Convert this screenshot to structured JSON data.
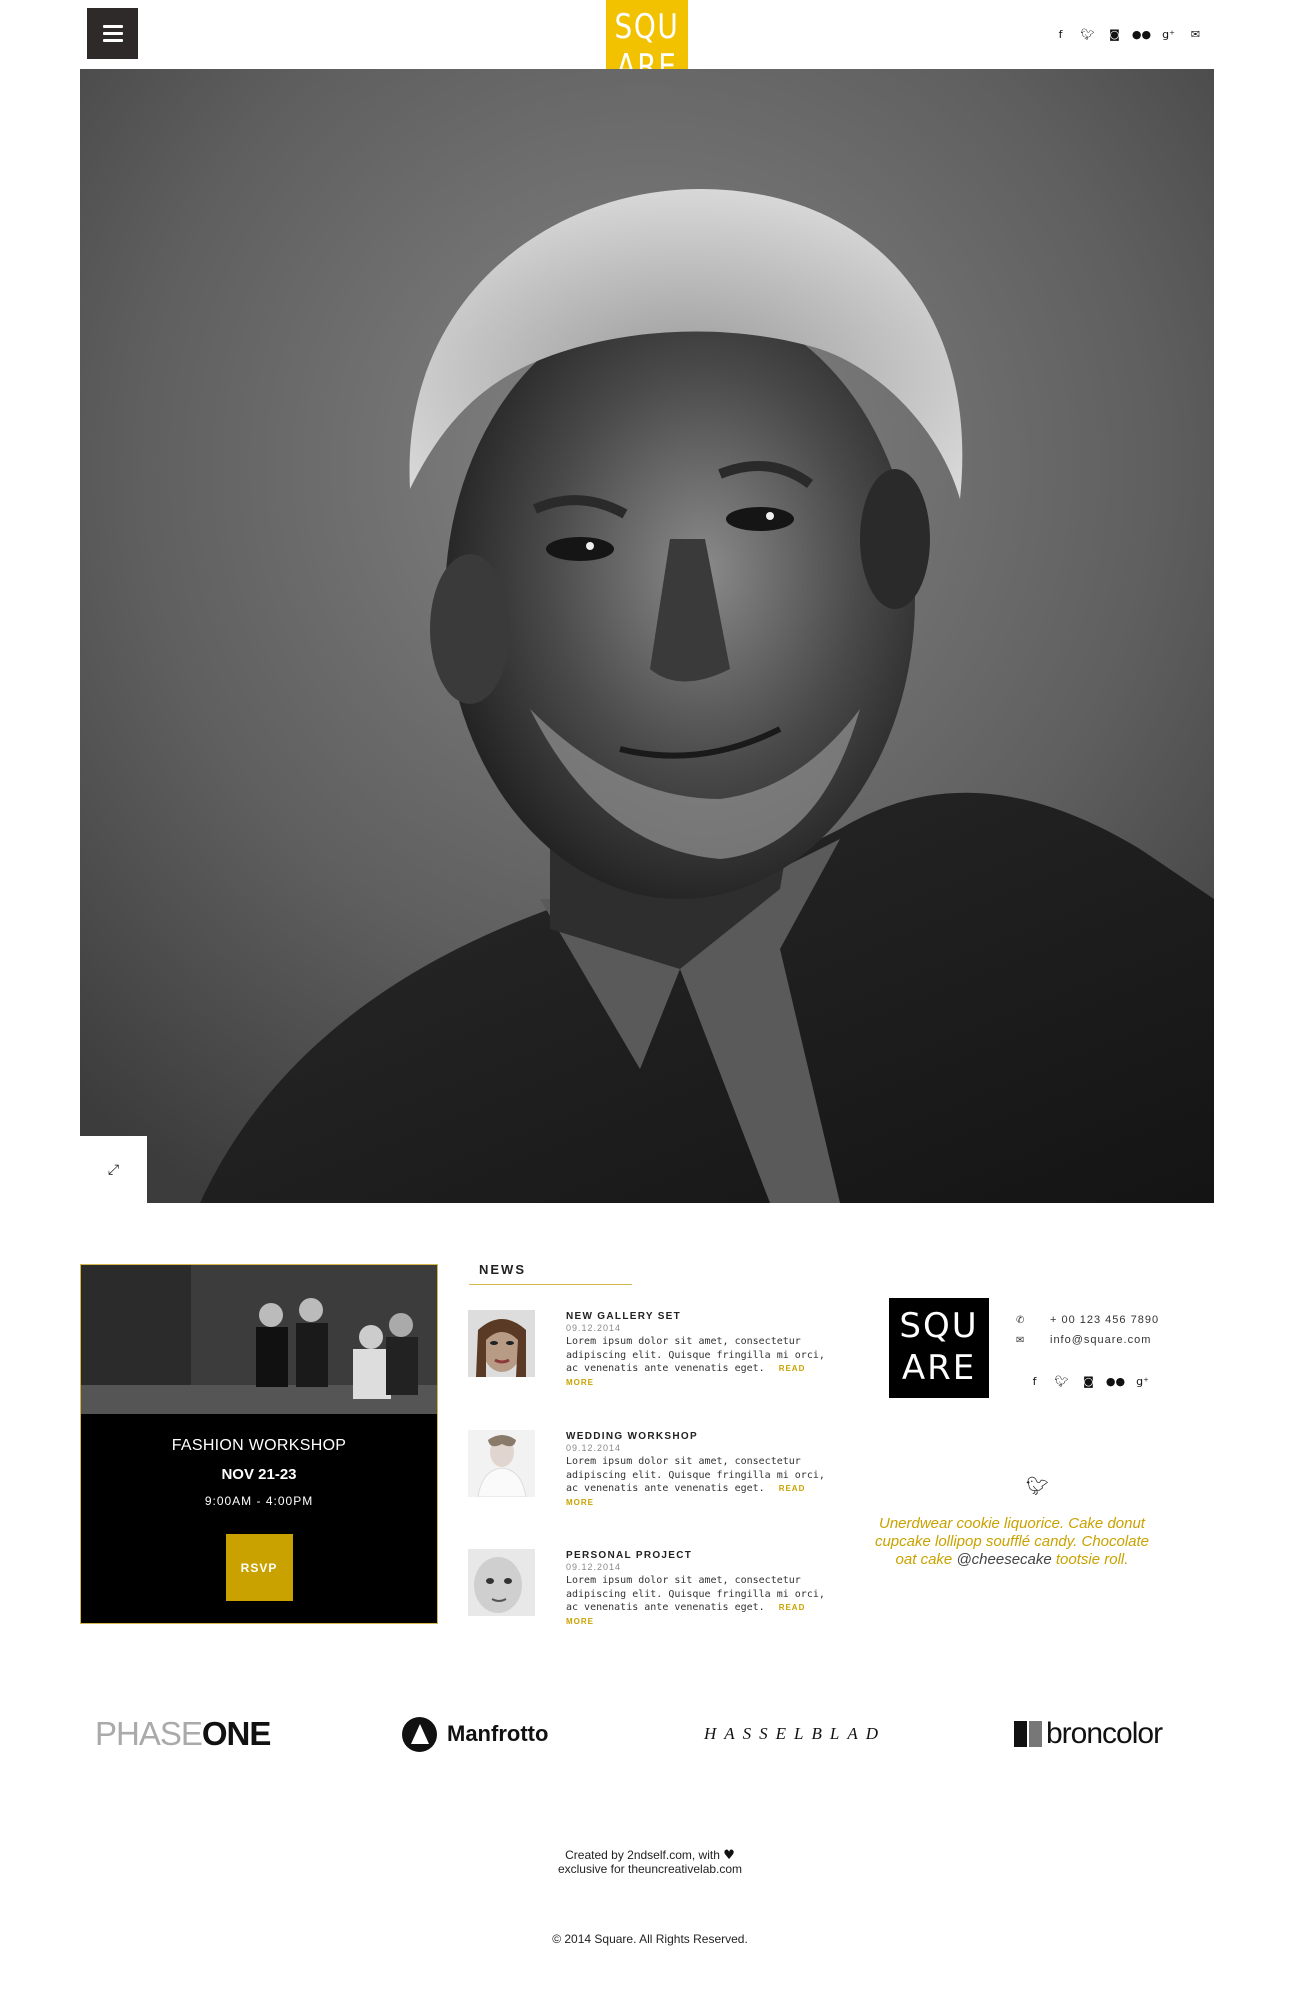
{
  "header": {
    "logo_line1": "SQU",
    "logo_line2": "ARE",
    "menu_icon": "hamburger-icon",
    "social_icons": [
      "facebook-icon",
      "twitter-icon",
      "instagram-icon",
      "flickr-icon",
      "google-plus-icon",
      "email-icon"
    ]
  },
  "hero": {
    "expand_icon": "expand-icon"
  },
  "event": {
    "title": "FASHION WORKSHOP",
    "date": "NOV 21-23",
    "time": "9:00AM - 4:00PM",
    "button_label": "RSVP"
  },
  "news": {
    "heading": "NEWS",
    "items": [
      {
        "title": "NEW GALLERY SET",
        "date": "09.12.2014",
        "text": "Lorem ipsum dolor sit amet, consectetur adipiscing elit. Quisque fringilla mi orci, ac venenatis ante venenatis eget.",
        "read_more": "READ MORE"
      },
      {
        "title": "WEDDING WORKSHOP",
        "date": "09.12.2014",
        "text": "Lorem ipsum dolor sit amet, consectetur adipiscing elit. Quisque fringilla mi orci, ac venenatis ante venenatis eget.",
        "read_more": "READ MORE"
      },
      {
        "title": "PERSONAL PROJECT",
        "date": "09.12.2014",
        "text": "Lorem ipsum dolor sit amet, consectetur adipiscing elit. Quisque fringilla mi orci, ac venenatis ante venenatis eget.",
        "read_more": "READ MORE"
      }
    ]
  },
  "contact": {
    "logo_line1": "SQU",
    "logo_line2": "ARE",
    "phone": "+ 00 123 456 7890",
    "email": "info@square.com"
  },
  "tweet": {
    "text_before": "Unerdwear cookie liquorice. Cake donut cupcake lollipop soufflé candy. Chocolate oat cake",
    "handle": "@cheesecake",
    "text_after": "tootsie roll."
  },
  "brands": {
    "phaseone_thin": "PHASE",
    "phaseone_bold": "ONE",
    "manfrotto": "Manfrotto",
    "hasselblad": "HASSELBLAD",
    "broncolor": "broncolor"
  },
  "footer": {
    "credit_line1": "Created by 2ndself.com, with",
    "credit_line2": "exclusive for theuncreativelab.com",
    "copyright": "© 2014 Square. All Rights Reserved."
  },
  "colors": {
    "accent": "#f2c200",
    "gold": "#c9a200",
    "dark": "#2f2a2a"
  }
}
